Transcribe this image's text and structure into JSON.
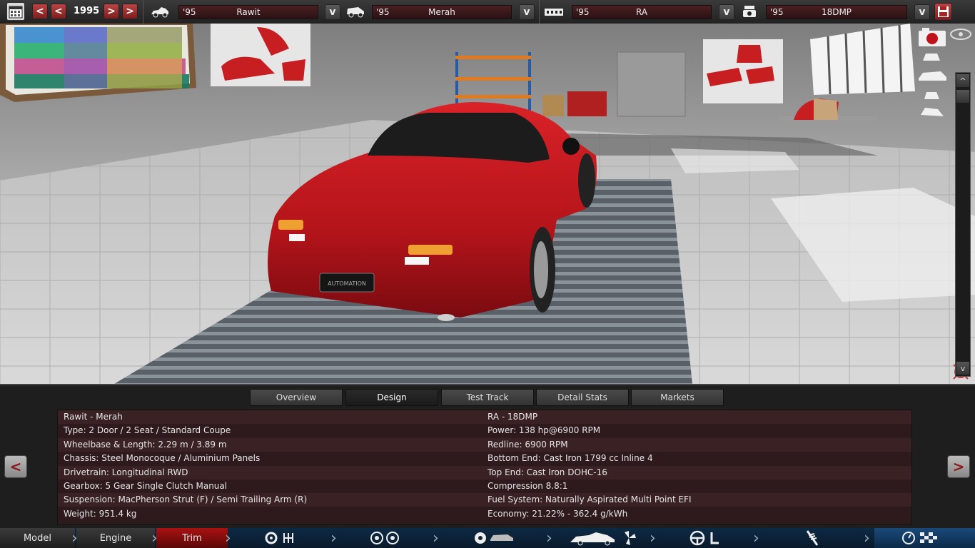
{
  "topbar": {
    "year": "1995",
    "model": {
      "year": "'95",
      "name": "Rawit"
    },
    "trim": {
      "year": "'95",
      "name": "Merah"
    },
    "engine": {
      "year": "'95",
      "name": "RA"
    },
    "variant": {
      "year": "'95",
      "name": "18DMP"
    },
    "prev_label": "<",
    "next_label": ">",
    "dropdown_label": "v"
  },
  "scene": {
    "car_color": "#c4151b",
    "plate_text": "AUTOMATION",
    "rightbar_up": "^",
    "rightbar_down": "v"
  },
  "tabs": [
    "Overview",
    "Design",
    "Test Track",
    "Detail Stats",
    "Markets"
  ],
  "active_tab": "Design",
  "info": {
    "left": [
      "Rawit - Merah",
      "Type: 2 Door / 2 Seat / Standard Coupe",
      "Wheelbase & Length: 2.29 m / 3.89 m",
      "Chassis: Steel Monocoque / Aluminium Panels",
      "Drivetrain: Longitudinal RWD",
      "Gearbox: 5 Gear Single Clutch Manual",
      "Suspension: MacPherson Strut (F) / Semi Trailing Arm (R)",
      "Weight: 951.4 kg"
    ],
    "right": [
      "RA - 18DMP",
      "Power: 138 hp@6900 RPM",
      "Redline: 6900 RPM",
      "Bottom End: Cast Iron 1799 cc Inline 4",
      "Top End: Cast Iron DOHC-16",
      "Compression 8.8:1",
      "Fuel System: Naturally Aspirated Multi Point EFI",
      "Economy: 21.22% - 362.4 g/kWh"
    ]
  },
  "nav": {
    "prev": "<",
    "next": ">"
  },
  "bottom_nav": {
    "model": "Model",
    "engine": "Engine",
    "trim": "Trim"
  }
}
